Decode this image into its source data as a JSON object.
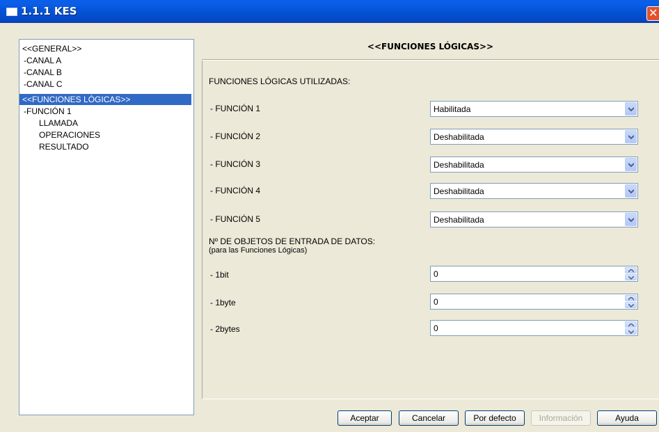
{
  "window": {
    "title": "1.1.1 KES"
  },
  "tree": {
    "items": [
      {
        "label": "<<GENERAL>>",
        "selected": false
      },
      {
        "label": "-CANAL A",
        "selected": false
      },
      {
        "label": "-CANAL B",
        "selected": false
      },
      {
        "label": "-CANAL C",
        "selected": false
      },
      {
        "label": "<<FUNCIONES LÓGICAS>>",
        "selected": true
      },
      {
        "label": "-FUNCIÓN 1",
        "selected": false
      },
      {
        "label": "LLAMADA",
        "selected": false
      },
      {
        "label": "OPERACIONES",
        "selected": false
      },
      {
        "label": "RESULTADO",
        "selected": false
      }
    ]
  },
  "panel": {
    "header": "<<FUNCIONES LÓGICAS>>",
    "section1": "FUNCIONES LÓGICAS UTILIZADAS:",
    "functions": [
      {
        "label": "- FUNCIÓN 1",
        "value": "Habilitada"
      },
      {
        "label": "- FUNCIÓN 2",
        "value": "Deshabilitada"
      },
      {
        "label": "- FUNCIÓN 3",
        "value": "Deshabilitada"
      },
      {
        "label": "- FUNCIÓN 4",
        "value": "Deshabilitada"
      },
      {
        "label": "- FUNCIÓN 5",
        "value": "Deshabilitada"
      }
    ],
    "section2": "Nº DE OBJETOS DE ENTRADA DE DATOS:",
    "section2_sub": "(para las Funciones Lógicas)",
    "inputs": [
      {
        "label": "- 1bit",
        "value": "0"
      },
      {
        "label": "- 1byte",
        "value": "0"
      },
      {
        "label": "- 2bytes",
        "value": "0"
      }
    ]
  },
  "buttons": {
    "accept": "Aceptar",
    "cancel": "Cancelar",
    "default": "Por defecto",
    "info": "Información",
    "help": "Ayuda"
  },
  "colors": {
    "titlebar": "#0453d4",
    "selection": "#316ac5",
    "dialog_bg": "#ece9d8"
  }
}
